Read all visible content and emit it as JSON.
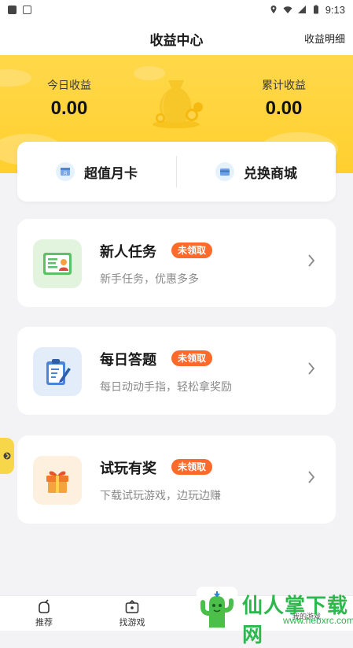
{
  "status_bar": {
    "time": "9:13",
    "left_icons": [
      "notification-square-icon",
      "a-app-icon"
    ],
    "right_icons": [
      "location-icon",
      "wifi-icon",
      "signal-icon",
      "battery-icon"
    ]
  },
  "header": {
    "title": "收益中心",
    "detail_link": "收益明细"
  },
  "earnings": {
    "today_label": "今日收益",
    "today_value": "0.00",
    "total_label": "累计收益",
    "total_value": "0.00"
  },
  "strip": [
    {
      "label": "超值月卡",
      "icon": "calendar-card-icon"
    },
    {
      "label": "兑换商城",
      "icon": "shop-card-icon"
    }
  ],
  "tasks": [
    {
      "title": "新人任务",
      "badge": "未领取",
      "desc": "新手任务，优惠多多",
      "icon": "id-card-icon",
      "icon_bg": "#e6f6e2"
    },
    {
      "title": "每日答题",
      "badge": "未领取",
      "desc": "每日动动手指，轻松拿奖励",
      "icon": "clipboard-pen-icon",
      "icon_bg": "#e4effb"
    },
    {
      "title": "试玩有奖",
      "badge": "未领取",
      "desc": "下载试玩游戏，边玩边赚",
      "icon": "gift-icon",
      "icon_bg": "#fdf1e1"
    }
  ],
  "bottom_nav": [
    {
      "label": "推荐",
      "icon": "recommend-icon"
    },
    {
      "label": "找游戏",
      "icon": "game-box-icon"
    },
    {
      "label": "我的游戏",
      "icon": "my-games-icon"
    }
  ],
  "watermark": {
    "text": "仙人掌下载网",
    "url": "www.hebxrc.com"
  },
  "colors": {
    "header_yellow": "#ffd43b",
    "badge_orange": "#ff6a2a",
    "page_bg": "#f3f3f5"
  }
}
